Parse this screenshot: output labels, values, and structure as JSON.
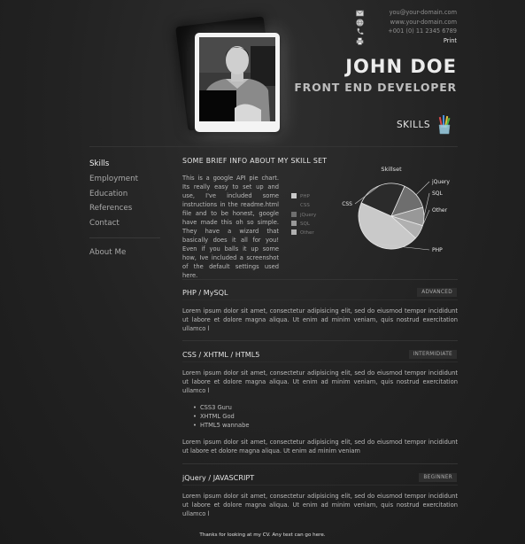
{
  "contact": {
    "email": "you@your-domain.com",
    "website": "www.your-domain.com",
    "phone": "+001 (0) 11 2345 6789",
    "print": "Print"
  },
  "header": {
    "name": "JOHN DOE",
    "role": "FRONT END DEVELOPER",
    "section": "SKILLS"
  },
  "nav": {
    "items": [
      "Skills",
      "Employment",
      "Education",
      "References",
      "Contact"
    ],
    "about": "About Me"
  },
  "intro": {
    "heading": "SOME BRIEF INFO ABOUT MY SKILL SET",
    "text": "This is a google API pie chart. Its really easy to set up and use, I've included some instructions in the readme.html file and to be honest, google have made this oh so simple. They have a wizard that basically does it all for you! Even if you balls it up some how, Ive included a screenshot of the default settings used here."
  },
  "chart_data": {
    "type": "pie",
    "title": "Skillset",
    "categories": [
      "PHP",
      "CSS",
      "jQuery",
      "SQL",
      "Other"
    ],
    "values": [
      45,
      25,
      14,
      9,
      7
    ],
    "colors": [
      "#c9c9c9",
      "#2b2b2b",
      "#6e6e6e",
      "#989898",
      "#b0b0b0"
    ],
    "legend": [
      "PHP",
      "CSS",
      "jQuery",
      "SQL",
      "Other"
    ]
  },
  "sections": [
    {
      "title": "PHP / MySQL",
      "level": "ADVANCED",
      "text": "Lorem ipsum dolor sit amet, consectetur adipisicing elit, sed do eiusmod tempor incididunt ut labore et dolore magna aliqua. Ut enim ad minim veniam, quis nostrud exercitation ullamco l"
    },
    {
      "title": "CSS / XHTML / HTML5",
      "level": "INTERMIDIATE",
      "text": "Lorem ipsum dolor sit amet, consectetur adipisicing elit, sed do eiusmod tempor incididunt ut labore et dolore magna aliqua. Ut enim ad minim veniam, quis nostrud exercitation ullamco l",
      "bullets": [
        "CSS3 Guru",
        "XHTML God",
        "HTML5 wannabe"
      ],
      "text2": "Lorem ipsum dolor sit amet, consectetur adipisicing elit, sed do eiusmod tempor incididunt ut labore et dolore magna aliqua. Ut enim ad minim veniam"
    },
    {
      "title": "jQuery / JAVASCRIPT",
      "level": "BEGINNER",
      "text": "Lorem ipsum dolor sit amet, consectetur adipisicing elit, sed do eiusmod tempor incididunt ut labore et dolore magna aliqua. Ut enim ad minim veniam, quis nostrud exercitation ullamco l"
    }
  ],
  "footer": "Thanks for looking at my CV. Any text can go here.",
  "icons": [
    "mail-icon",
    "globe-icon",
    "phone-icon",
    "printer-icon",
    "pencils-icon"
  ]
}
